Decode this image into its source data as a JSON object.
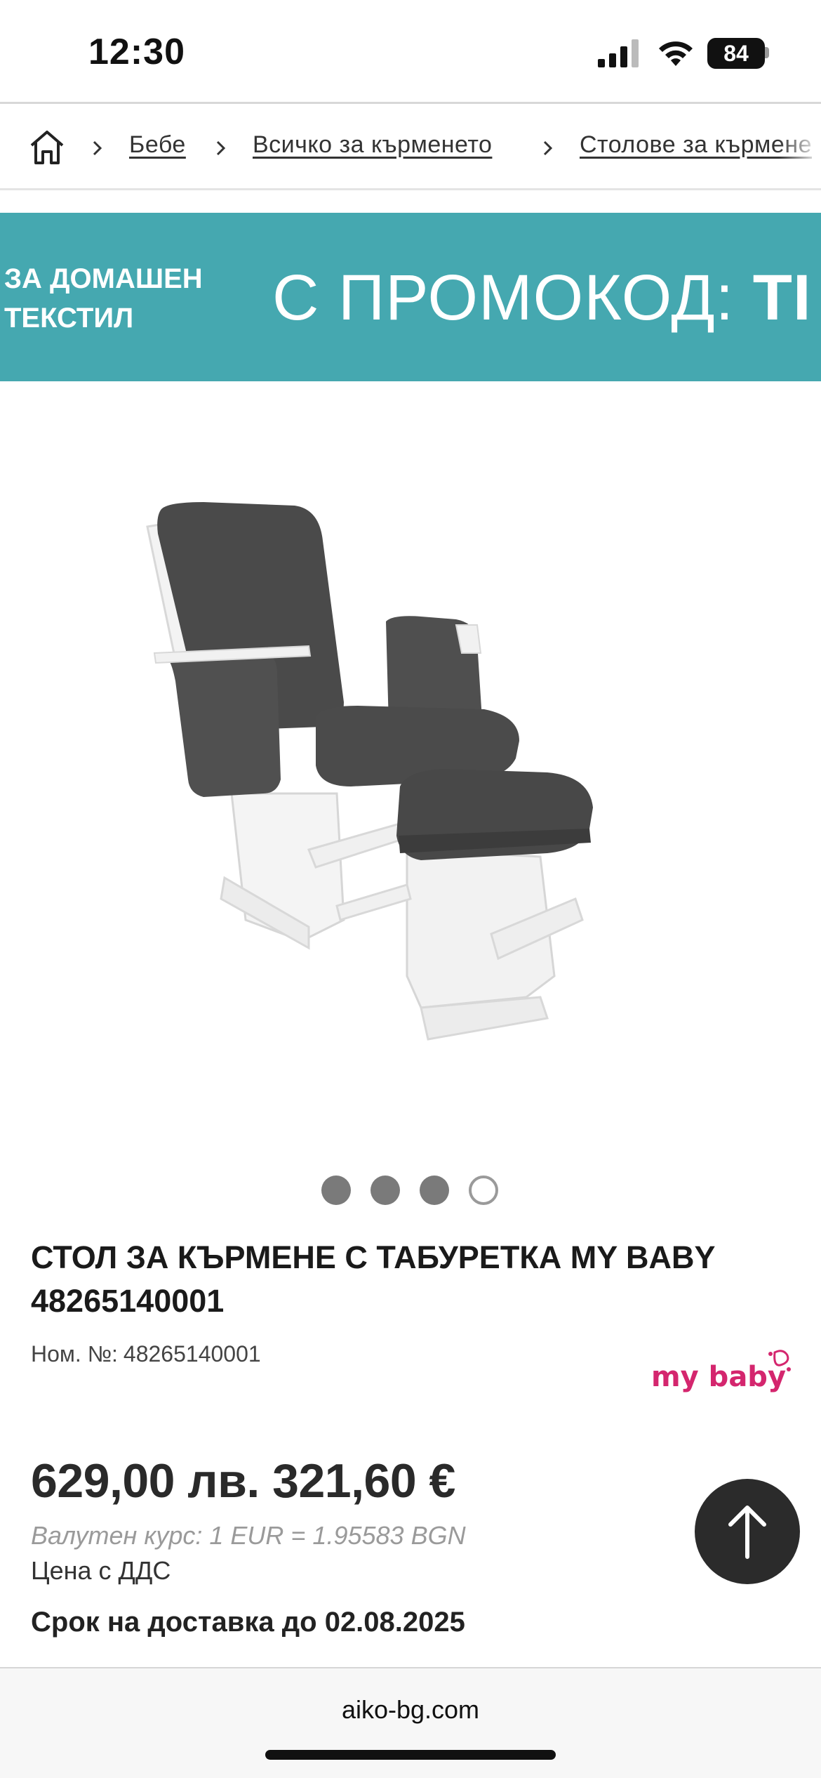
{
  "status_bar": {
    "time": "12:30",
    "battery": "84",
    "icons": [
      "signal-icon",
      "wifi-icon",
      "battery-icon"
    ]
  },
  "breadcrumb": {
    "home_icon": "home-icon",
    "separator_icon": "chevron-right-icon",
    "items": [
      {
        "label": "Бебе"
      },
      {
        "label": "Всичко за кърменето"
      },
      {
        "label": "Столове за кърмене"
      }
    ]
  },
  "promo": {
    "left_line1": "ЗА ДОМАШЕН",
    "left_line2": "ТЕКСТИЛ",
    "main_text": "С ПРОМОКОД:",
    "code_visible": "TI",
    "background": "#45a8b0"
  },
  "gallery": {
    "dot_count": 4,
    "active_index": 3
  },
  "product": {
    "title": "СТОЛ ЗА КЪРМЕНЕ С ТАБУРЕТКА MY BABY 48265140001",
    "sku_label": "Ном. №:",
    "sku_value": "48265140001",
    "brand": "my baby",
    "price": "629,00 лв. 321,60 €",
    "exchange_rate": "Валутен курс: 1 EUR = 1.95583 BGN",
    "vat_note": "Цена с ДДС",
    "delivery": "Срок на доставка до 02.08.2025"
  },
  "scroll_top": {
    "icon": "arrow-up-icon"
  },
  "browser": {
    "url": "aiko-bg.com"
  },
  "colors": {
    "accent": "#45a8b0",
    "brand": "#d4266e",
    "dark_button": "#2b2b2b"
  }
}
